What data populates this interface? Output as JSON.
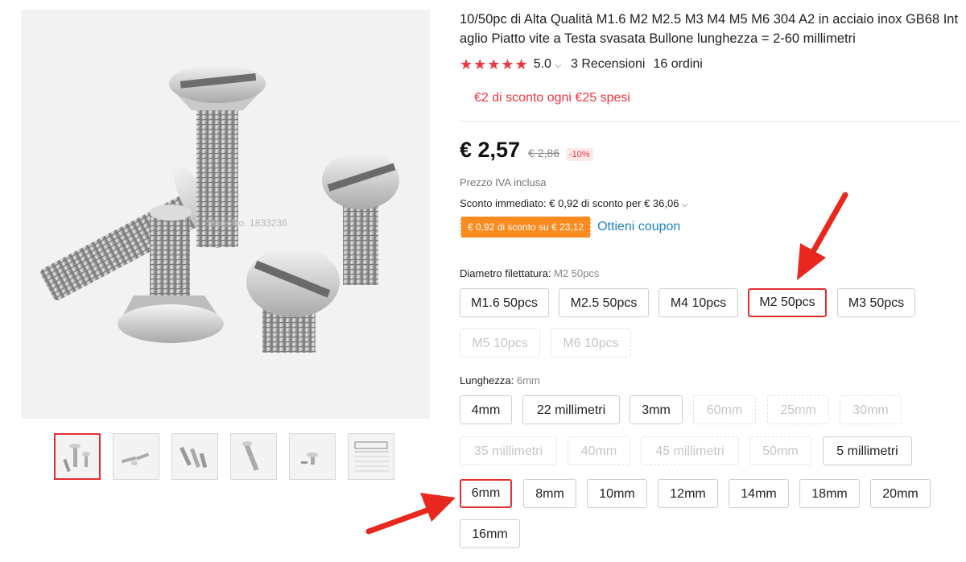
{
  "gallery": {
    "watermark": "Store No. 1833236",
    "thumbnail_count": 6,
    "active_thumbnail": 1
  },
  "product": {
    "title": "10/50pc di Alta Qualità M1.6 M2 M2.5 M3 M4 M5 M6 304 A2 in acciaio inox GB68 Intaglio Piatto vite a Testa svasata Bullone lunghezza = 2-60 millimetri",
    "stars": "★★★★★",
    "rating": "5.0",
    "reviews": "3 Recensioni",
    "orders": "16 ordini",
    "promo": "€2 di sconto ogni €25 spesi"
  },
  "pricing": {
    "price": "€ 2,57",
    "original_price": "€ 2,86",
    "discount": "-10%",
    "vat_note": "Prezzo IVA inclusa",
    "instant_discount": "Sconto immediato: € 0,92 di sconto per € 36,06",
    "coupon_tag": "€ 0,92 di sconto su € 23,12",
    "coupon_link": "Ottieni coupon"
  },
  "thread_diameter": {
    "label": "Diametro filettatura:",
    "selected_value": "M2 50pcs",
    "options": [
      {
        "label": "M1.6 50pcs",
        "state": "available"
      },
      {
        "label": "M2.5 50pcs",
        "state": "available"
      },
      {
        "label": "M4 10pcs",
        "state": "available"
      },
      {
        "label": "M2 50pcs",
        "state": "selected"
      },
      {
        "label": "M3 50pcs",
        "state": "available"
      },
      {
        "label": "M5 10pcs",
        "state": "disabled"
      },
      {
        "label": "M6 10pcs",
        "state": "disabled"
      }
    ]
  },
  "length": {
    "label": "Lunghezza:",
    "selected_value": "6mm",
    "options": [
      {
        "label": "4mm",
        "state": "available"
      },
      {
        "label": "22 millimetri",
        "state": "available"
      },
      {
        "label": "3mm",
        "state": "available"
      },
      {
        "label": "60mm",
        "state": "disabled"
      },
      {
        "label": "25mm",
        "state": "disabled"
      },
      {
        "label": "30mm",
        "state": "disabled"
      },
      {
        "label": "35 millimetri",
        "state": "disabled"
      },
      {
        "label": "40mm",
        "state": "disabled"
      },
      {
        "label": "45 millimetri",
        "state": "disabled"
      },
      {
        "label": "50mm",
        "state": "disabled"
      },
      {
        "label": "5 millimetri",
        "state": "available"
      },
      {
        "label": "6mm",
        "state": "selected"
      },
      {
        "label": "8mm",
        "state": "available"
      },
      {
        "label": "10mm",
        "state": "available"
      },
      {
        "label": "12mm",
        "state": "available"
      },
      {
        "label": "14mm",
        "state": "available"
      },
      {
        "label": "18mm",
        "state": "available"
      },
      {
        "label": "20mm",
        "state": "available"
      },
      {
        "label": "16mm",
        "state": "available"
      }
    ]
  },
  "colors": {
    "accent_red": "#e62e2e",
    "star_red": "#f2343d",
    "coupon_orange": "#fb8a1f",
    "link_blue": "#1d81c5"
  }
}
